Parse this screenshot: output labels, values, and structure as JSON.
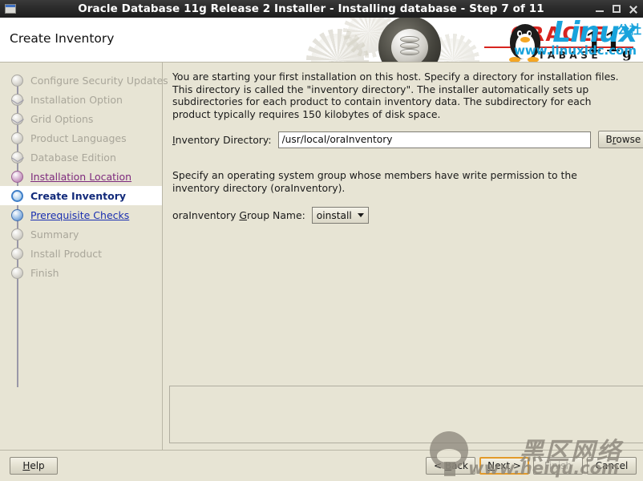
{
  "window": {
    "title": "Oracle Database 11g Release 2 Installer - Installing database - Step 7 of 11",
    "icon": "window-icon",
    "controls": {
      "minimize": "–",
      "maximize": "□",
      "close": "✕"
    }
  },
  "banner": {
    "page_title": "Create Inventory",
    "logo_word": "ORACLE",
    "logo_sub": "DATABASE",
    "logo_version": "11",
    "logo_version_sub": "g",
    "watermark_brand": "Linux",
    "watermark_brand_cn": "公社",
    "watermark_url": "www.linuxidc.com"
  },
  "sidebar": {
    "items": [
      {
        "label": "Configure Security Updates",
        "state": "done",
        "node": "gray",
        "branch": false
      },
      {
        "label": "Installation Option",
        "state": "done",
        "node": "gray",
        "branch": true
      },
      {
        "label": "Grid Options",
        "state": "done",
        "node": "gray",
        "branch": true
      },
      {
        "label": "Product Languages",
        "state": "done",
        "node": "gray",
        "branch": false
      },
      {
        "label": "Database Edition",
        "state": "done",
        "node": "gray",
        "branch": true
      },
      {
        "label": "Installation Location",
        "state": "visited",
        "node": "purple",
        "branch": false
      },
      {
        "label": "Create Inventory",
        "state": "current",
        "node": "blue-ring",
        "branch": false
      },
      {
        "label": "Prerequisite Checks",
        "state": "link",
        "node": "blue",
        "branch": false
      },
      {
        "label": "Summary",
        "state": "done",
        "node": "gray",
        "branch": false
      },
      {
        "label": "Install Product",
        "state": "done",
        "node": "gray",
        "branch": false
      },
      {
        "label": "Finish",
        "state": "done",
        "node": "gray",
        "branch": false
      }
    ]
  },
  "main": {
    "intro": "You are starting your first installation on this host. Specify a directory for installation files. This directory is called the \"inventory directory\". The installer automatically sets up subdirectories for each product to contain inventory data. The subdirectory for each product typically requires 150 kilobytes of disk space.",
    "inventory_label": "Inventory Directory:",
    "inventory_value": "/usr/local/oraInventory",
    "inventory_placeholder": "/usr/local/oraInventory",
    "browse_label": "Browse",
    "para2": "Specify an operating system group whose members have write permission to the inventory directory (oraInventory).",
    "group_label": "oraInventory Group Name:",
    "group_value": "oinstall",
    "group_options": [
      "oinstall"
    ],
    "message_panel_text": ""
  },
  "footer": {
    "help_label": "Help",
    "back_label": "< Back",
    "next_label": "Next >",
    "finish_label": "Finish",
    "cancel_label": "Cancel",
    "watermark_cn": "黑区网络",
    "watermark_url": "www.heiqu.com"
  },
  "colors": {
    "background": "#e7e4d4",
    "titlebar": "#2b2b2b",
    "oracle_red": "#d8241f",
    "current_text": "#122a7a",
    "link_blue": "#1a2fb0",
    "link_purple": "#7d2a7d",
    "focus_orange": "#e39a2a"
  }
}
